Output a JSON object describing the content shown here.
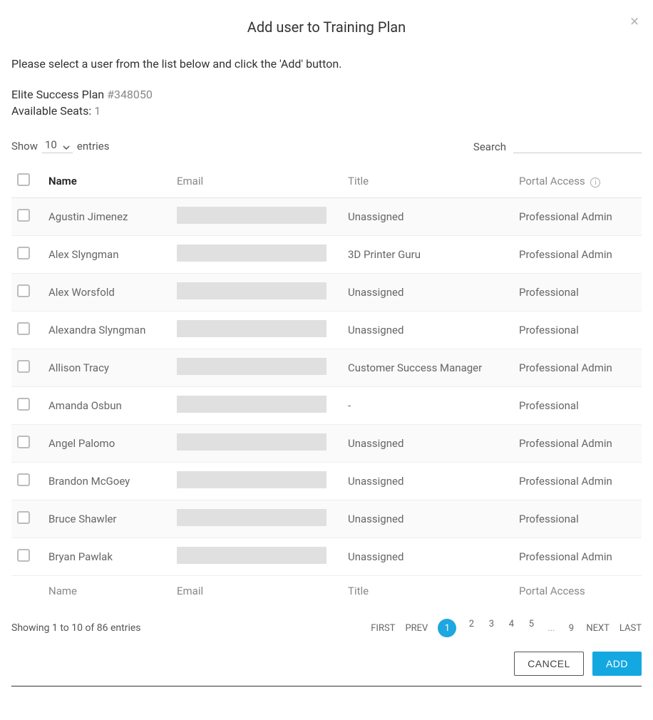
{
  "modal": {
    "title": "Add user to Training Plan",
    "close_glyph": "×"
  },
  "intro": "Please select a user from the list below and click the 'Add' button.",
  "plan": {
    "name": "Elite Success Plan",
    "id": "#348050",
    "seats_label": "Available Seats:",
    "seats_count": "1"
  },
  "controls": {
    "show_label": "Show",
    "entries_value": "10",
    "entries_suffix": "entries",
    "search_label": "Search"
  },
  "columns": {
    "name": "Name",
    "email": "Email",
    "title": "Title",
    "access": "Portal Access"
  },
  "footer_columns": {
    "name": "Name",
    "email": "Email",
    "title": "Title",
    "access": "Portal Access"
  },
  "rows": [
    {
      "name": "Agustin Jimenez",
      "title": "Unassigned",
      "access": "Professional Admin"
    },
    {
      "name": "Alex Slyngman",
      "title": "3D Printer Guru",
      "access": "Professional Admin"
    },
    {
      "name": "Alex Worsfold",
      "title": "Unassigned",
      "access": "Professional"
    },
    {
      "name": "Alexandra Slyngman",
      "title": "Unassigned",
      "access": "Professional"
    },
    {
      "name": "Allison Tracy",
      "title": "Customer Success Manager",
      "access": "Professional Admin"
    },
    {
      "name": "Amanda Osbun",
      "title": "-",
      "access": "Professional"
    },
    {
      "name": "Angel Palomo",
      "title": "Unassigned",
      "access": "Professional Admin"
    },
    {
      "name": "Brandon McGoey",
      "title": "Unassigned",
      "access": "Professional Admin"
    },
    {
      "name": "Bruce Shawler",
      "title": "Unassigned",
      "access": "Professional"
    },
    {
      "name": "Bryan Pawlak",
      "title": "Unassigned",
      "access": "Professional Admin"
    }
  ],
  "summary": "Showing 1 to 10 of 86 entries",
  "pagination": {
    "first": "FIRST",
    "prev": "PREV",
    "pages": [
      "1",
      "2",
      "3",
      "4",
      "5"
    ],
    "ellipsis": "...",
    "last_page": "9",
    "next": "NEXT",
    "last": "LAST",
    "current_index": 0
  },
  "buttons": {
    "cancel": "CANCEL",
    "add": "ADD"
  },
  "icons": {
    "info_glyph": "i"
  }
}
